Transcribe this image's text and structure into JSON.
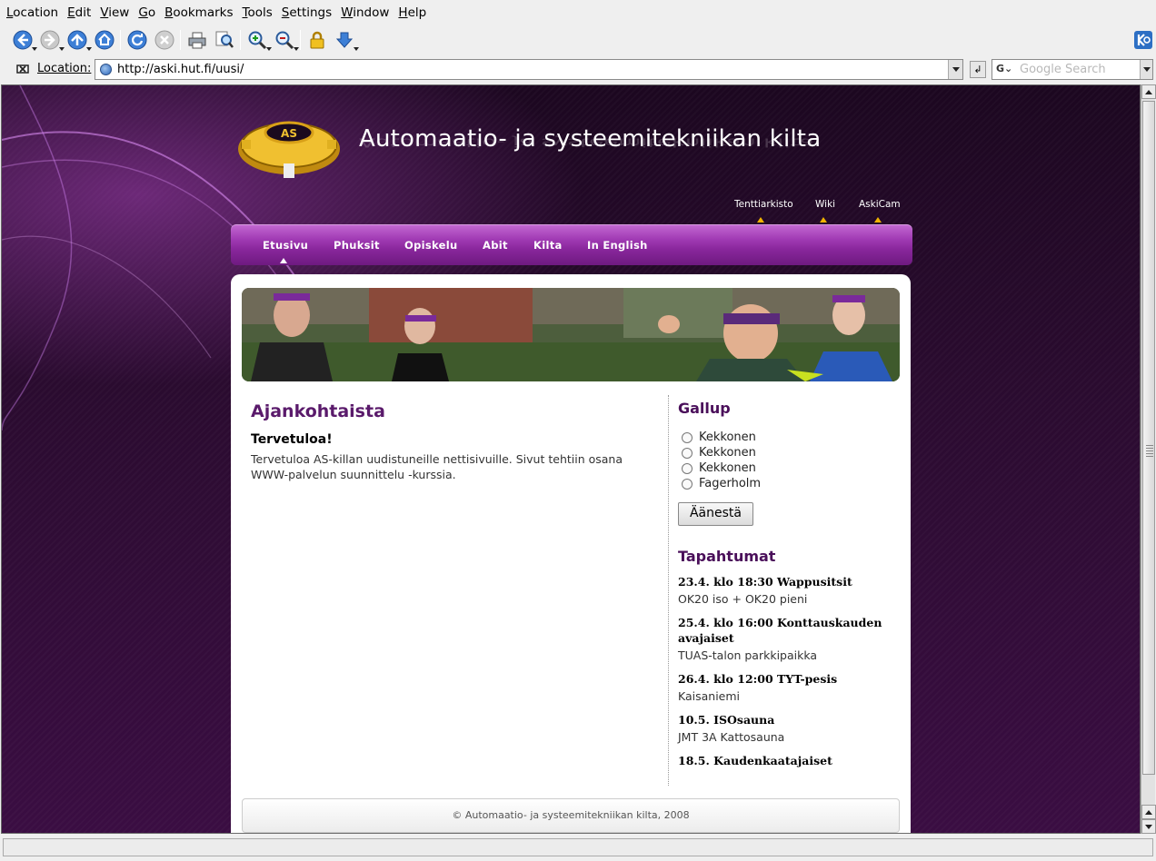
{
  "menubar": {
    "items": [
      "Location",
      "Edit",
      "View",
      "Go",
      "Bookmarks",
      "Tools",
      "Settings",
      "Window",
      "Help"
    ]
  },
  "toolbar": {
    "icons": [
      "back-icon",
      "forward-icon",
      "up-icon",
      "home-icon",
      "reload-icon",
      "stop-icon",
      "print-icon",
      "find-icon",
      "zoom-in-icon",
      "zoom-out-icon",
      "security-icon",
      "download-icon",
      "kde-logo-icon"
    ]
  },
  "location": {
    "label": "Location:",
    "url": "http://aski.hut.fi/uusi/",
    "search_engine": "Google",
    "search_placeholder": "Google Search",
    "go_label": "↲"
  },
  "site": {
    "title": "Automaatio- ja systeemitekniikan kilta",
    "logo_text": "AS",
    "toplinks": [
      "Tenttiarkisto",
      "Wiki",
      "AskiCam"
    ],
    "nav": [
      "Etusivu",
      "Phuksit",
      "Opiskelu",
      "Abit",
      "Kilta",
      "In English"
    ],
    "active_nav": "Etusivu"
  },
  "news": {
    "heading": "Ajankohtaista",
    "title": "Tervetuloa!",
    "body": "Tervetuloa AS-killan uudistuneille nettisivuille. Sivut tehtiin osana WWW-palvelun suunnittelu -kurssia."
  },
  "poll": {
    "heading": "Gallup",
    "options": [
      "Kekkonen",
      "Kekkonen",
      "Kekkonen",
      "Fagerholm"
    ],
    "vote_label": "Äänestä"
  },
  "events": {
    "heading": "Tapahtumat",
    "items": [
      {
        "title": "23.4. klo 18:30 Wappusitsit",
        "place": "OK20 iso + OK20 pieni"
      },
      {
        "title": "25.4. klo 16:00 Konttauskauden avajaiset",
        "place": "TUAS-talon parkkipaikka"
      },
      {
        "title": "26.4. klo 12:00 TYT-pesis",
        "place": "Kaisaniemi"
      },
      {
        "title": "10.5. ISOsauna",
        "place": "JMT 3A Kattosauna"
      },
      {
        "title": "18.5. Kaudenkaatajaiset",
        "place": ""
      }
    ]
  },
  "footer": {
    "text": "© Automaatio- ja systeemitekniikan kilta, 2008"
  },
  "colors": {
    "accent": "#8a279d",
    "heading": "#5a1a6b",
    "arrow": "#f0b400"
  }
}
